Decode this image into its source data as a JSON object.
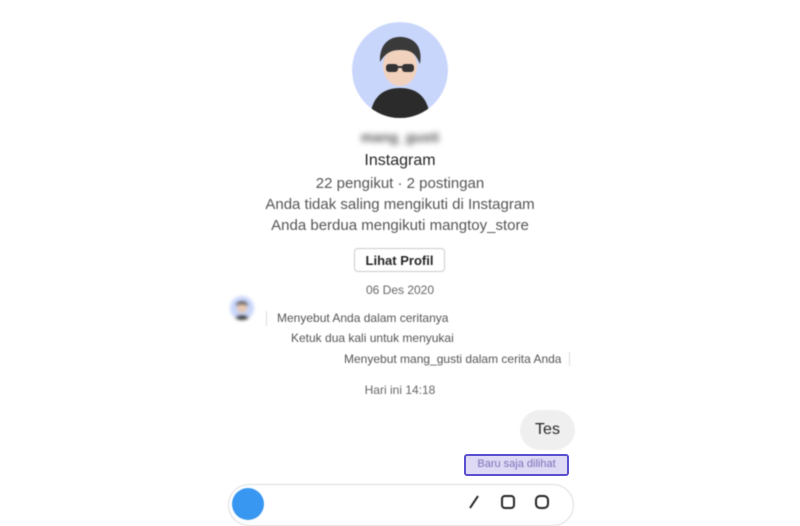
{
  "profile": {
    "username": "mang_gusti",
    "app_name": "Instagram",
    "stats": "22 pengikut · 2 postingan",
    "follow_status": "Anda tidak saling mengikuti di Instagram",
    "mutual": "Anda berdua mengikuti mangtoy_store",
    "view_profile_label": "Lihat Profil"
  },
  "chat": {
    "date_header_1": "06 Des 2020",
    "story_mention_received": "Menyebut Anda dalam ceritanya",
    "double_tap_hint": "Ketuk dua kali untuk menyukai",
    "story_mention_sent": "Menyebut mang_gusti dalam cerita Anda",
    "date_header_2": "Hari ini 14:18",
    "sent_message": "Tes",
    "seen_status": "Baru saja dilihat"
  },
  "icons": {
    "camera": "camera-icon",
    "mic": "microphone-icon",
    "gallery": "gallery-icon",
    "sticker": "sticker-icon"
  },
  "colors": {
    "accent": "#3897f0",
    "highlight_border": "#5a4fcf",
    "bubble": "#efefef"
  }
}
